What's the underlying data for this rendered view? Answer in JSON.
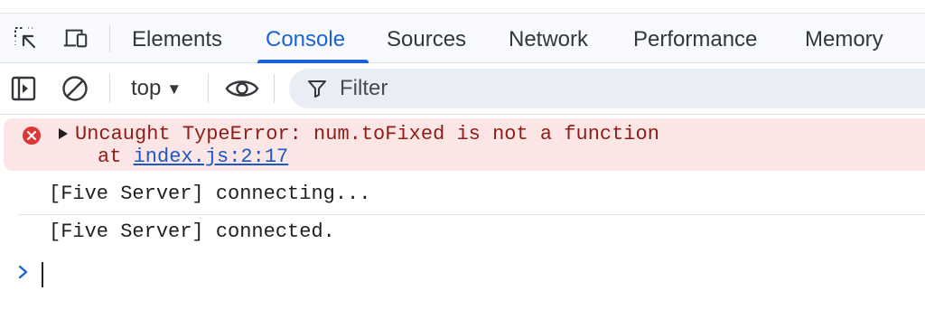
{
  "tabs": [
    {
      "label": "Elements",
      "active": false
    },
    {
      "label": "Console",
      "active": true
    },
    {
      "label": "Sources",
      "active": false
    },
    {
      "label": "Network",
      "active": false
    },
    {
      "label": "Performance",
      "active": false
    },
    {
      "label": "Memory",
      "active": false
    }
  ],
  "icons": {
    "inspect": "inspect-element-icon",
    "device": "device-toolbar-icon",
    "sidebar": "show-sidebar-icon",
    "clear": "clear-console-icon",
    "eye": "live-expression-eye-icon",
    "filter": "filter-icon",
    "error": "error-icon",
    "expand": "expand-triangle-icon",
    "prompt": "prompt-chevron-icon"
  },
  "toolbar": {
    "context": "top",
    "filter_placeholder": "Filter"
  },
  "console": {
    "error": {
      "message": "Uncaught TypeError: num.toFixed is not a function",
      "at_prefix": "at ",
      "link": "index.js:2:17"
    },
    "logs": [
      "[Five Server] connecting...",
      "[Five Server] connected."
    ]
  },
  "colors": {
    "accent": "#1a63d6",
    "error_bg": "#fbe6e5",
    "error_text": "#8c1d18",
    "error_icon": "#dc3636",
    "link": "#1a59c8"
  }
}
